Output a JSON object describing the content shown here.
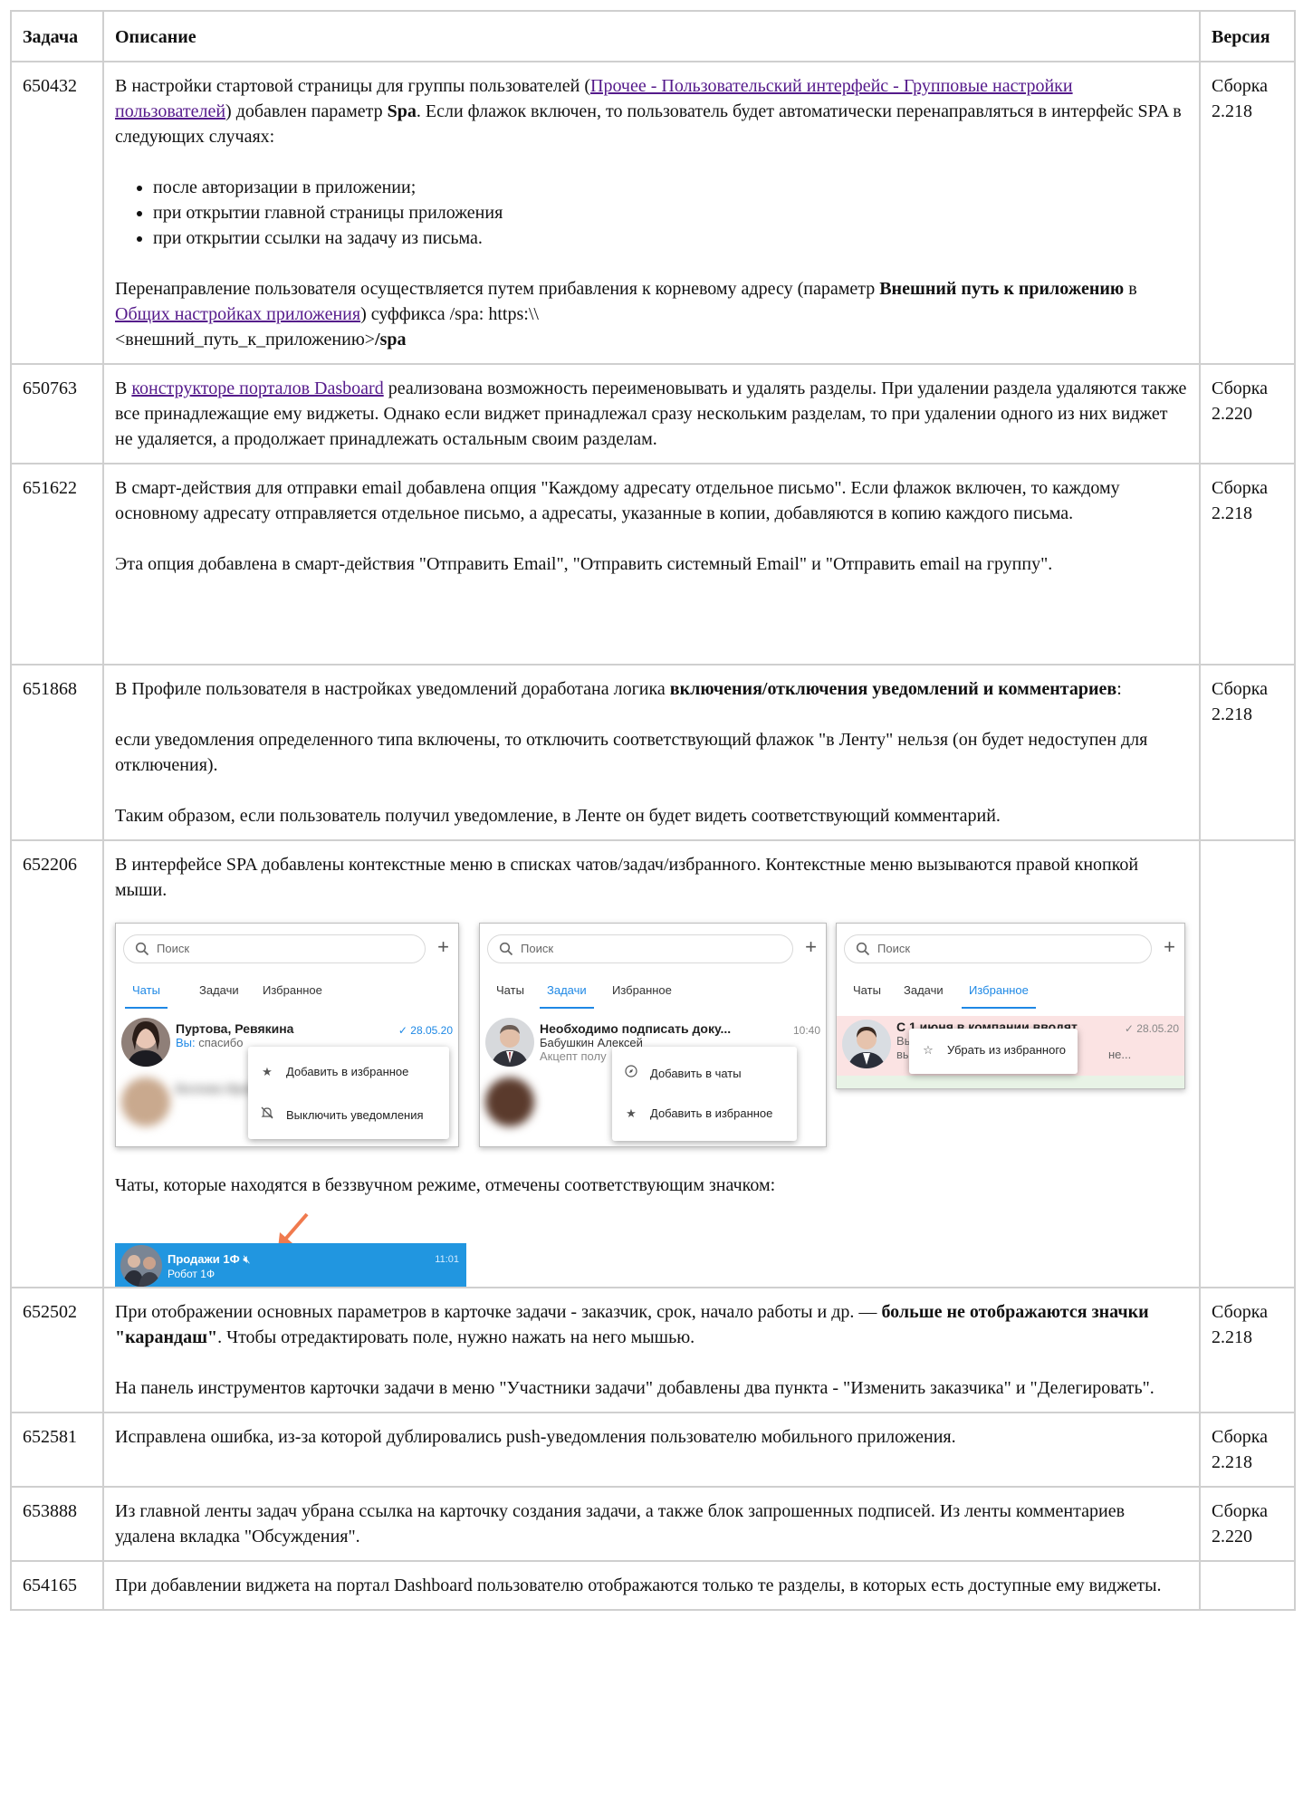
{
  "headers": {
    "task": "Задача",
    "description": "Описание",
    "version": "Версия"
  },
  "rows": {
    "r1": {
      "id": "650432",
      "version": "Сборка 2.218",
      "p1_a": "В настройки стартовой страницы для группы пользователей (",
      "p1_link": "Прочее - Пользовательский интерфейс - Групповые настройки пользователей",
      "p1_b": ") добавлен параметр ",
      "p1_bold": "Spa",
      "p1_c": ". Если флажок включен, то пользователь будет автоматически перенаправляться в интерфейс SPA в следующих случаях:",
      "bullets": [
        "после авторизации в приложении;",
        "при открытии главной страницы приложения",
        "при открытии ссылки на задачу из письма."
      ],
      "p2_a": "Перенаправление пользователя осуществляется путем прибавления к корневому адресу (параметр ",
      "p2_bold": "Внешний путь к приложению",
      "p2_b": " в ",
      "p2_link": "Общих настройках приложения",
      "p2_c": ") суффикса /spa: https:\\\\",
      "p2_d": "<внешний_путь_к_приложению>",
      "p2_bold2": "/spa"
    },
    "r2": {
      "id": "650763",
      "version": "Сборка 2.220",
      "a": "В ",
      "link": "конструкторе порталов Dasboard",
      "b": " реализована возможность переименовывать и удалять разделы. При удалении раздела удаляются также все принадлежащие ему виджеты. Однако если виджет принадлежал сразу нескольким разделам, то при удалении одного из них виджет не удаляется, а продолжает принадлежать остальным своим разделам."
    },
    "r3": {
      "id": "651622",
      "version": "Сборка 2.218",
      "p1": "В смарт-действия для отправки email добавлена опция \"Каждому адресату отдельное письмо\". Если флажок включен, то каждому основному адресату отправляется отдельное письмо, а адресаты, указанные в копии, добавляются в копию каждого письма.",
      "p2": "Эта опция добавлена в смарт-действия \"Отправить Email\", \"Отправить системный Email\" и \"Отправить email на группу\"."
    },
    "r4": {
      "id": "651868",
      "version": "Сборка 2.218",
      "p1_a": "В Профиле пользователя в настройках уведомлений доработана логика ",
      "p1_bold": "включения/отключения уведомлений и комментариев",
      "p1_b": ":",
      "p2": "если уведомления определенного типа включены, то отключить соответствующий флажок \"в Ленту\" нельзя (он будет недоступен для отключения).",
      "p3": "Таким образом, если пользователь получил уведомление, в Ленте он будет видеть соответствующий комментарий."
    },
    "r5": {
      "id": "652206",
      "version": "",
      "p1": "В интерфейсе SPA добавлены контекстные меню в списках чатов/задач/избранного. Контекстные меню вызываются правой кнопкой мыши.",
      "p2": "Чаты, которые находятся в беззвучном режиме, отмечены соответствующим значком:"
    },
    "r6": {
      "id": "652502",
      "version": "Сборка 2.218",
      "p1_a": "При отображении основных параметров в карточке задачи - заказчик, срок, начало работы и др. — ",
      "p1_bold": "больше не отображаются значки \"карандаш\"",
      "p1_b": ". Чтобы отредактировать поле, нужно нажать на него мышью.",
      "p2": "На панель инструментов карточки задачи в меню \"Участники задачи\" добавлены два пункта - \"Изменить заказчика\" и \"Делегировать\"."
    },
    "r7": {
      "id": "652581",
      "version": "Сборка 2.218",
      "p1": "Исправлена ошибка, из-за которой дублировались push-уведомления пользователю мобильного приложения."
    },
    "r8": {
      "id": "653888",
      "version": "Сборка 2.220",
      "p1": "Из главной ленты задач убрана ссылка на карточку создания задачи, а также блок запрошенных подписей. Из ленты комментариев удалена вкладка \"Обсуждения\"."
    },
    "r9": {
      "id": "654165",
      "version": "",
      "p1": "При добавлении виджета на портал Dashboard пользователю отображаются только те разделы, в которых есть доступные ему виджеты."
    }
  },
  "shots": {
    "search_placeholder": "Поиск",
    "tabs": [
      "Чаты",
      "Задачи",
      "Избранное"
    ],
    "s1": {
      "name": "Пуртова, Ревякина",
      "vy": "Вы:",
      "sub": " спасибо",
      "time": "✓ 28.05.20",
      "blurred_name": "Белова Ирина",
      "menu": [
        "Добавить в избранное",
        "Выключить уведомления"
      ]
    },
    "s2": {
      "name": "Необходимо подписать доку...",
      "author": "Бабушкин Алексей",
      "sub": "Акцепт полу",
      "time": "10:40",
      "menu": [
        "Добавить в чаты",
        "Добавить в избранное"
      ]
    },
    "s3": {
      "name": "С 1 июня в компании вводят",
      "vy": "Вы: д",
      "sub": "выве",
      "tail": "не...",
      "time": "✓ 28.05.20",
      "menu": [
        "Убрать из избранного"
      ]
    },
    "chat": {
      "name": "Продажи 1Ф",
      "sub": "Робот 1Ф",
      "time": "11:01"
    }
  },
  "colors": {
    "link": "#551a8b",
    "spa_blue": "#1e88e5",
    "chat_bar": "#2196e0",
    "arrow": "#f07a4e",
    "fav_row": "#fbe3e3"
  }
}
